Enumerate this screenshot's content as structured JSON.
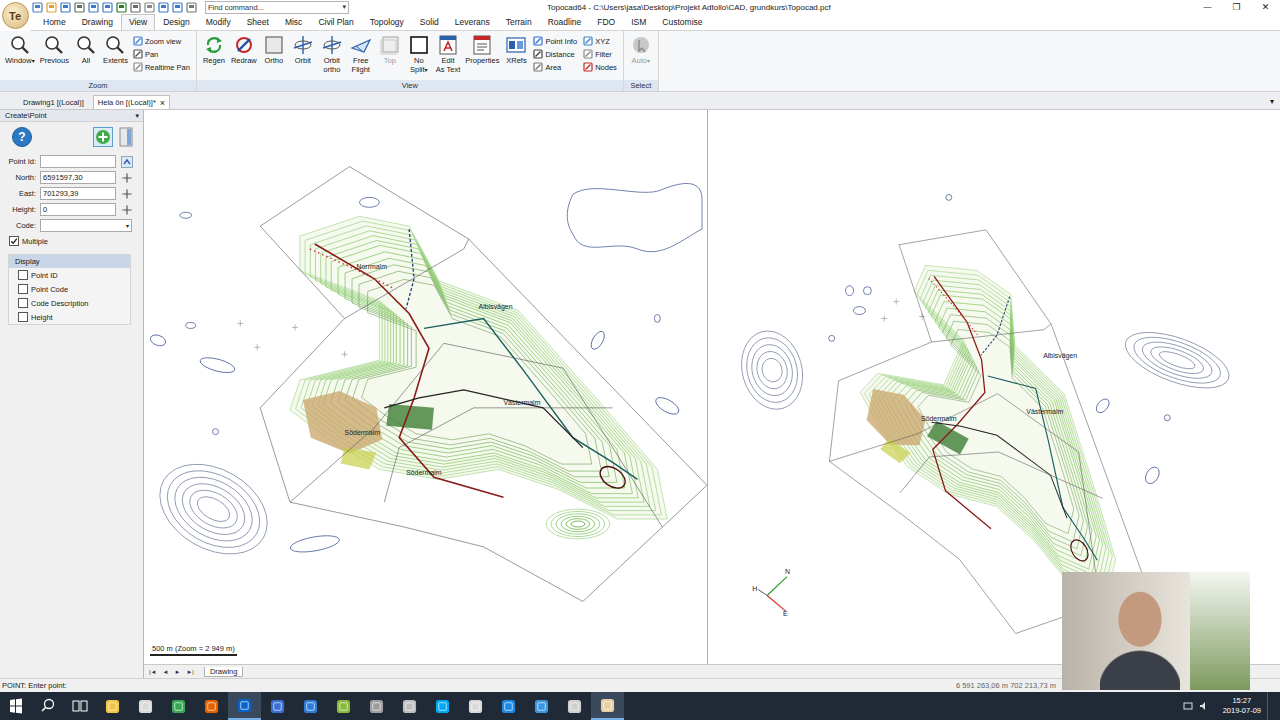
{
  "window": {
    "title": "Topocad64 - C:\\Users\\jasa\\Desktop\\Projekt Adtollo\\CAD, grundkurs\\Topocad.pcf",
    "controls": [
      "—",
      "❐",
      "✕"
    ]
  },
  "app_logo": "Te",
  "quick_access": {
    "search_placeholder": "Find command...",
    "search_arrow": "▾"
  },
  "menu_tabs": [
    {
      "label": "Home",
      "selected": false
    },
    {
      "label": "Drawing",
      "selected": false
    },
    {
      "label": "View",
      "selected": true
    },
    {
      "label": "Design",
      "selected": false
    },
    {
      "label": "Modify",
      "selected": false
    },
    {
      "label": "Sheet",
      "selected": false
    },
    {
      "label": "Misc",
      "selected": false
    },
    {
      "label": "Civil Plan",
      "selected": false
    },
    {
      "label": "Topology",
      "selected": false
    },
    {
      "label": "Solid",
      "selected": false
    },
    {
      "label": "Leverans",
      "selected": false
    },
    {
      "label": "Terrain",
      "selected": false
    },
    {
      "label": "Roadline",
      "selected": false
    },
    {
      "label": "FDO",
      "selected": false
    },
    {
      "label": "ISM",
      "selected": false
    },
    {
      "label": "Customise",
      "selected": false
    }
  ],
  "ribbon": {
    "groups": [
      {
        "label": "Zoom",
        "columns": [
          {
            "kind": "large",
            "items": [
              {
                "label": "Window",
                "arrow": "▾",
                "disabled": false
              },
              {
                "label": "Previous",
                "disabled": false
              },
              {
                "label": "All",
                "disabled": false
              },
              {
                "label": "Extents",
                "disabled": false
              }
            ]
          },
          {
            "kind": "small",
            "items": [
              {
                "label": "Zoom view",
                "disabled": false
              },
              {
                "label": "Pan",
                "disabled": false
              },
              {
                "label": "Realtime Pan",
                "disabled": false
              }
            ]
          }
        ]
      },
      {
        "label": "View",
        "columns": [
          {
            "kind": "large",
            "items": [
              {
                "label": "Regen",
                "disabled": false
              },
              {
                "label": "Redraw",
                "disabled": false
              },
              {
                "label": "Ortho",
                "disabled": false
              },
              {
                "label": "Orbit",
                "disabled": false
              },
              {
                "label": "Orbit\northo",
                "disabled": false
              },
              {
                "label": "Free\nFlight",
                "disabled": false
              },
              {
                "label": "Top",
                "disabled": true
              },
              {
                "label": "No\nSplit",
                "arrow": "▾",
                "disabled": false
              },
              {
                "label": "Edit\nAs Text",
                "disabled": false
              },
              {
                "label": "Properties",
                "disabled": false
              },
              {
                "label": "XRefs",
                "disabled": false
              }
            ]
          },
          {
            "kind": "small",
            "items": [
              {
                "label": "Point Info",
                "disabled": false
              },
              {
                "label": "Distance",
                "disabled": false
              },
              {
                "label": "Area",
                "disabled": false
              }
            ]
          },
          {
            "kind": "small",
            "items": [
              {
                "label": "XYZ",
                "disabled": false
              },
              {
                "label": "Filter",
                "disabled": false
              },
              {
                "label": "Nodes",
                "disabled": false
              }
            ]
          }
        ]
      },
      {
        "label": "Select",
        "columns": [
          {
            "kind": "large",
            "items": [
              {
                "label": "Auto",
                "arrow": "▾",
                "disabled": true
              }
            ]
          }
        ]
      }
    ]
  },
  "document_tabs": [
    {
      "label": "Drawing1 [(Local)]",
      "selected": false
    },
    {
      "label": "Hela ön [(Local)]*",
      "selected": true,
      "close": "×"
    }
  ],
  "tabs_menu_arrow": "▾",
  "side_panel": {
    "title": "Create\\Point",
    "title_arrow": "▾",
    "help": "?",
    "fields": [
      {
        "label": "Point Id:",
        "value": "",
        "kind": "id"
      },
      {
        "label": "North:",
        "value": "6591597,30",
        "kind": "coord"
      },
      {
        "label": "East:",
        "value": "701293,39",
        "kind": "coord"
      },
      {
        "label": "Height:",
        "value": "0",
        "kind": "coord"
      },
      {
        "label": "Code:",
        "value": "",
        "kind": "select",
        "arrow": "▾"
      }
    ],
    "multiple": {
      "label": "Multiple",
      "checked": true
    },
    "display": {
      "title": "Display",
      "options": [
        {
          "label": "Point ID",
          "checked": false
        },
        {
          "label": "Point Code",
          "checked": false
        },
        {
          "label": "Code Description",
          "checked": false
        },
        {
          "label": "Height",
          "checked": false
        }
      ]
    }
  },
  "viewports": [
    {
      "labels": [
        "Norrmalm",
        "Albisvägen",
        "Västermalm",
        "Södermalm",
        "Södermalm"
      ],
      "scale": "500 m (Zoom = 2 949 m)"
    },
    {
      "labels": [
        "Albisvägen",
        "Västermalm",
        "Södermalm"
      ],
      "axes": {
        "north": "N",
        "height": "H",
        "east": "E"
      }
    }
  ],
  "sheet_tabs": {
    "nav": [
      "|◄",
      "◄",
      "►",
      "►|"
    ],
    "tabs": [
      {
        "label": "Drawing",
        "selected": true
      }
    ]
  },
  "status_bar": {
    "prompt": "POINT: Enter point:",
    "coordinates": "6 591 263,06 m 702 213,73 m"
  },
  "taskbar": {
    "apps": [
      {
        "color": "#f4c542",
        "active": false
      },
      {
        "color": "#d9d9d9",
        "active": false
      },
      {
        "color": "#3aa757",
        "active": false
      },
      {
        "color": "#e66000",
        "active": false
      },
      {
        "color": "#0a64c8",
        "active": true
      },
      {
        "color": "#3b6fd6",
        "active": false
      },
      {
        "color": "#2f7bd8",
        "active": false
      },
      {
        "color": "#8ab83c",
        "active": false
      },
      {
        "color": "#9e9e9e",
        "active": false
      },
      {
        "color": "#bdbdbd",
        "active": false
      },
      {
        "color": "#00a9f4",
        "active": false
      },
      {
        "color": "#d9d9d9",
        "active": false
      },
      {
        "color": "#1e88e5",
        "active": false
      },
      {
        "color": "#3a96dd",
        "active": false
      },
      {
        "color": "#cfcfcf",
        "active": false
      },
      {
        "color": "#e6cfa4",
        "active": true
      }
    ],
    "time": "15:27",
    "date": "2019-07-09"
  }
}
